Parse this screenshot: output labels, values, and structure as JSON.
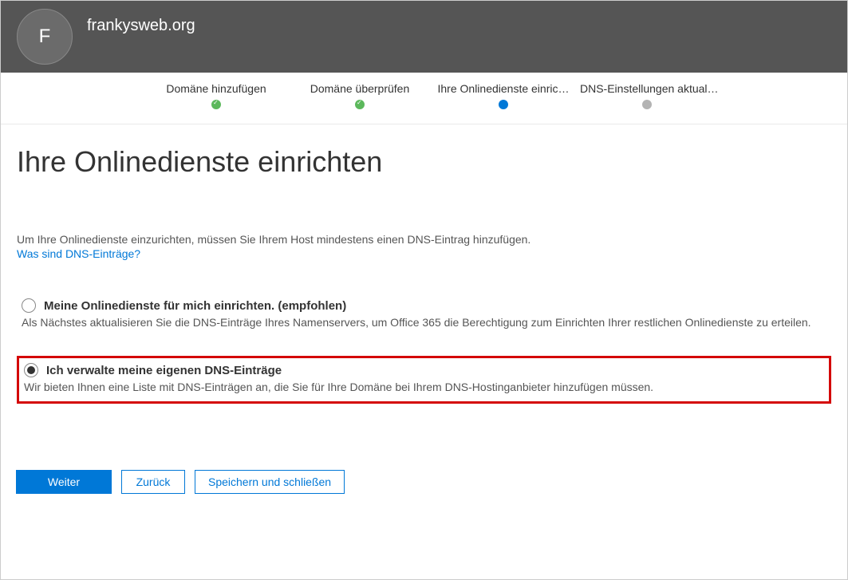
{
  "header": {
    "avatar_letter": "F",
    "domain": "frankysweb.org"
  },
  "stepper": {
    "steps": [
      {
        "label": "Domäne hinzufügen",
        "status": "done"
      },
      {
        "label": "Domäne überprüfen",
        "status": "done"
      },
      {
        "label": "Ihre Onlinedienste einric…",
        "status": "current"
      },
      {
        "label": "DNS-Einstellungen aktual…",
        "status": "pending"
      }
    ]
  },
  "page": {
    "title": "Ihre Onlinedienste einrichten",
    "intro": "Um Ihre Onlinedienste einzurichten, müssen Sie Ihrem Host mindestens einen DNS-Eintrag hinzufügen.",
    "help_link": "Was sind DNS-Einträge?"
  },
  "options": [
    {
      "label": "Meine Onlinedienste für mich einrichten. (empfohlen)",
      "desc": "Als Nächstes aktualisieren Sie die DNS-Einträge Ihres Namenservers, um Office 365 die Berechtigung zum Einrichten Ihrer restlichen Onlinedienste zu erteilen.",
      "selected": false
    },
    {
      "label": "Ich verwalte meine eigenen DNS-Einträge",
      "desc": "Wir bieten Ihnen eine Liste mit DNS-Einträgen an, die Sie für Ihre Domäne bei Ihrem DNS-Hostinganbieter hinzufügen müssen.",
      "selected": true
    }
  ],
  "buttons": {
    "next": "Weiter",
    "back": "Zurück",
    "save_close": "Speichern und schließen"
  }
}
